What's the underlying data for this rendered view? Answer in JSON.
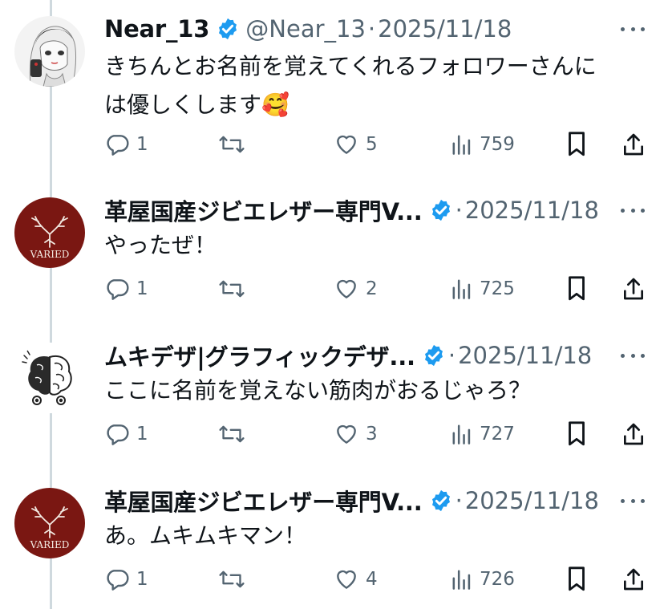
{
  "tweets": [
    {
      "name": "Near_13",
      "handle": "@Near_13",
      "separator": "·",
      "date": "2025/11/18",
      "text_line1": "きちんとお名前を覚えてくれるフォロワーさんに",
      "text_line2": "は優しくします",
      "emoji": "🥰",
      "replies": "1",
      "retweets": "",
      "likes": "5",
      "views": "759",
      "avatar": "anime-girl-avatar"
    },
    {
      "name": "革屋国産ジビエレザー専門V...",
      "handle": "",
      "separator": "·",
      "date": "2025/11/18",
      "text_line1": "やったぜ！",
      "replies": "1",
      "retweets": "",
      "likes": "2",
      "views": "725",
      "avatar": "varied-logo",
      "avatar_text": "VARIED",
      "avatar_color": "#7a1712"
    },
    {
      "name": "ムキデザ|グラフィックデザ...",
      "handle": "",
      "separator": "·",
      "date": "2025/11/18",
      "text_line1": "ここに名前を覚えない筋肉がおるじゃろ？",
      "replies": "1",
      "retweets": "",
      "likes": "3",
      "views": "727",
      "avatar": "brain-character-avatar"
    },
    {
      "name": "革屋国産ジビエレザー専門V...",
      "handle": "",
      "separator": "·",
      "date": "2025/11/18",
      "text_line1": "あ。ムキムキマン！",
      "replies": "1",
      "retweets": "",
      "likes": "4",
      "views": "726",
      "avatar": "varied-logo",
      "avatar_text": "VARIED",
      "avatar_color": "#7a1712"
    }
  ],
  "colors": {
    "verified": "#1d9bf0",
    "secondary_text": "#536471",
    "thread_line": "#cfd9de"
  }
}
